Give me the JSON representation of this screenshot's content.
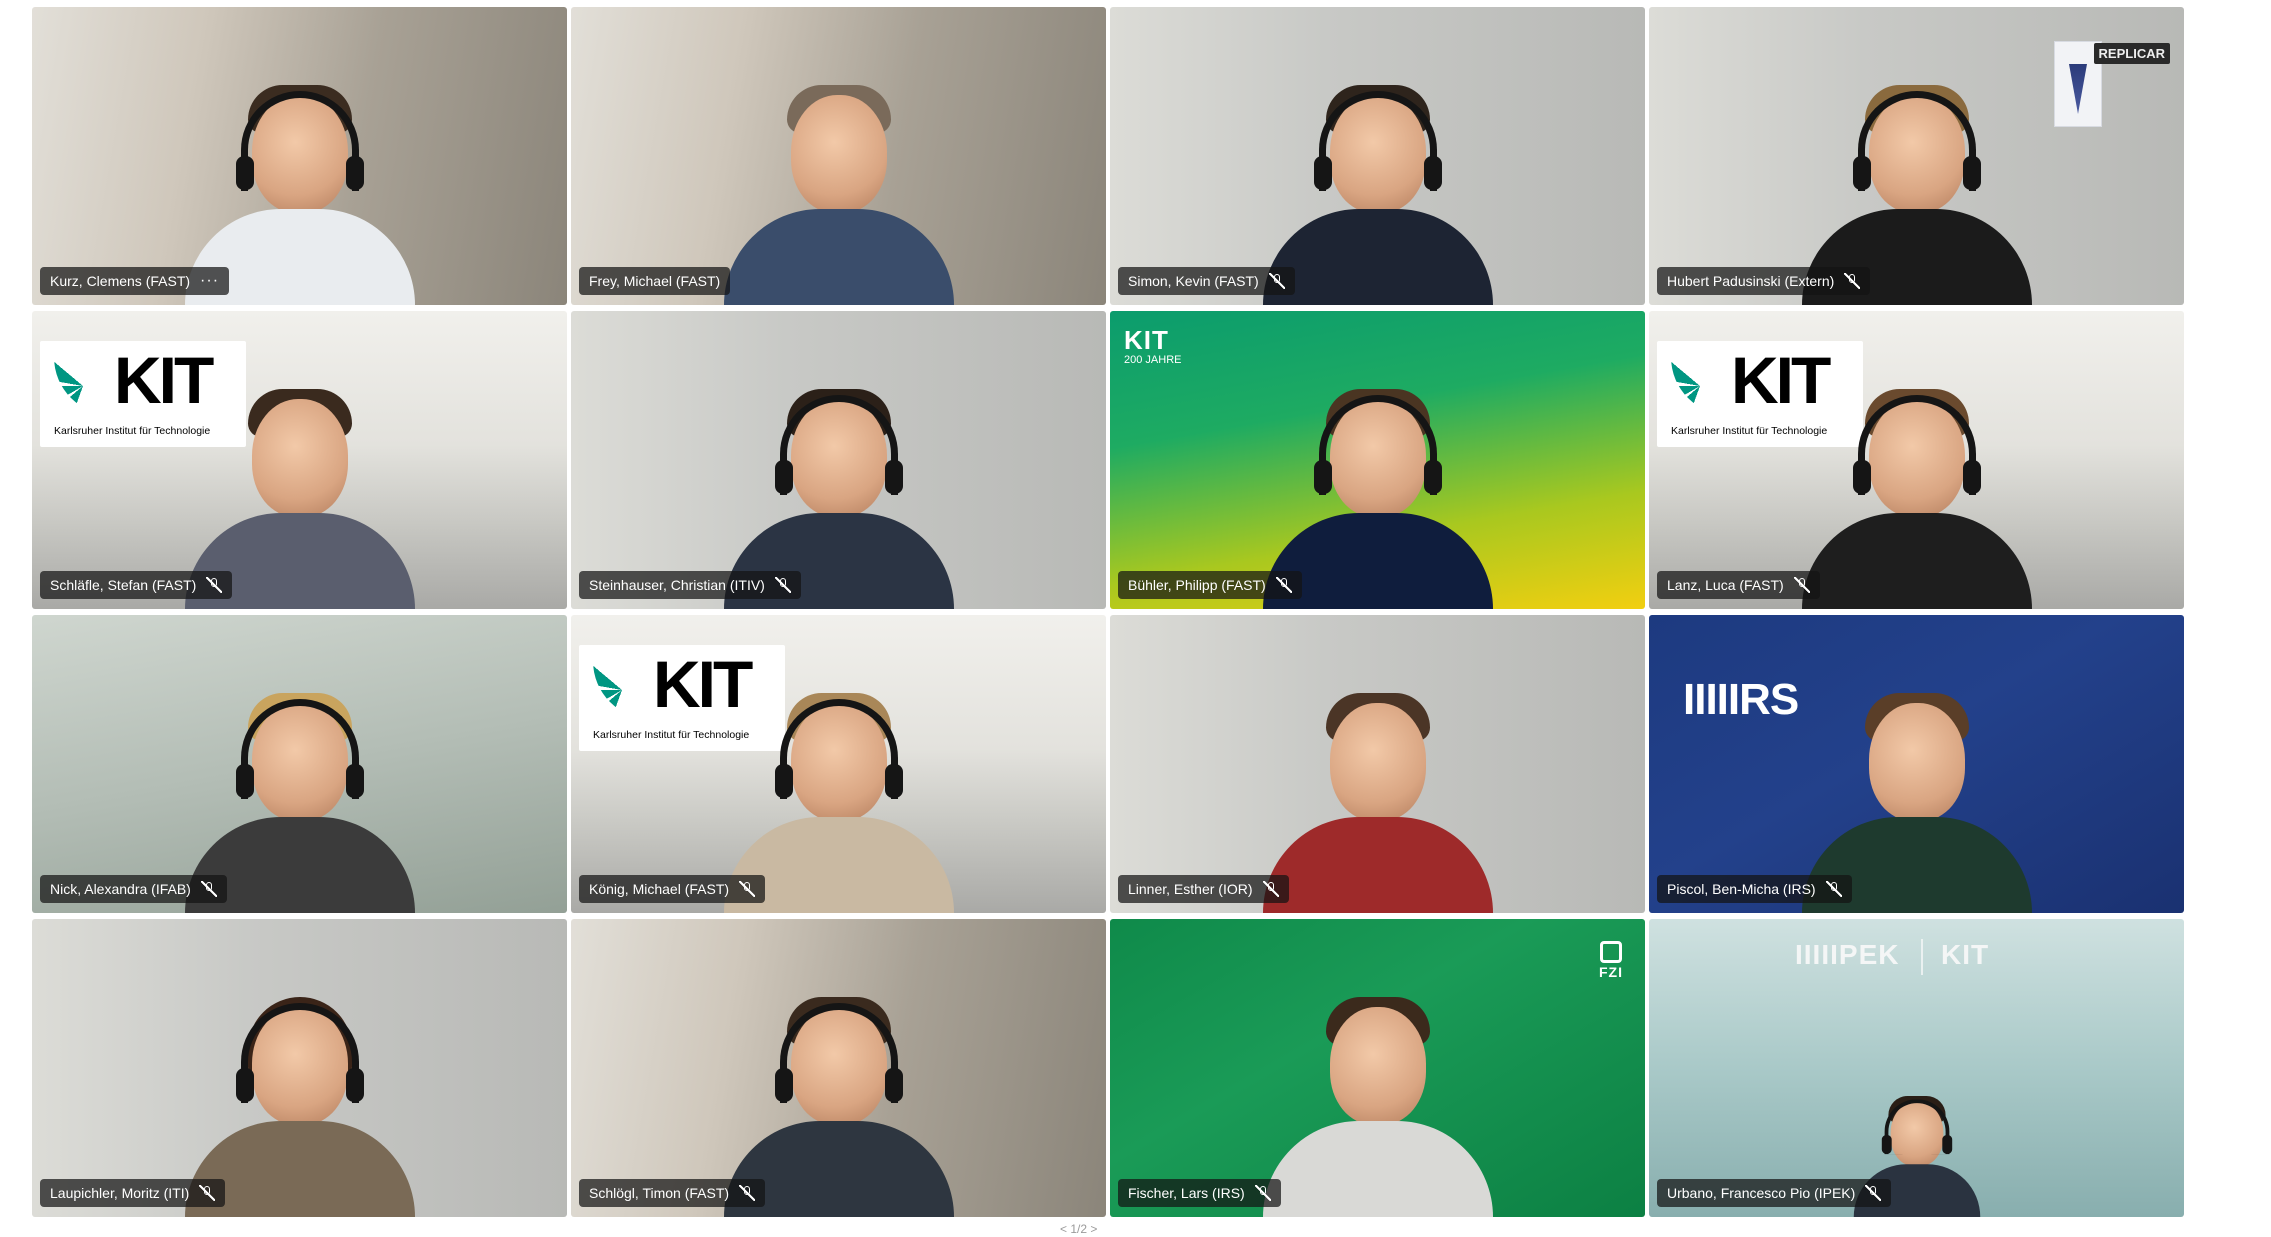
{
  "participants": [
    {
      "name": "Kurz, Clemens (FAST)",
      "control": "more",
      "more_label": "···"
    },
    {
      "name": "Frey, Michael (FAST)",
      "control": "none"
    },
    {
      "name": "Simon, Kevin (FAST)",
      "control": "muted"
    },
    {
      "name": "Hubert Padusinski (Extern)",
      "control": "muted",
      "logo_text": "REPLICAR"
    },
    {
      "name": "Schläfle, Stefan (FAST)",
      "control": "muted",
      "logo_text": "KIT",
      "logo_sub": "Karlsruher Institut für Technologie"
    },
    {
      "name": "Steinhauser, Christian (ITIV)",
      "control": "muted"
    },
    {
      "name": "Bühler, Philipp (FAST)",
      "control": "muted",
      "logo_text": "KIT",
      "logo_sub": "200 JAHRE"
    },
    {
      "name": "Lanz, Luca (FAST)",
      "control": "muted",
      "logo_text": "KIT",
      "logo_sub": "Karlsruher Institut für Technologie"
    },
    {
      "name": "Nick, Alexandra (IFAB)",
      "control": "muted"
    },
    {
      "name": "König, Michael (FAST)",
      "control": "muted",
      "logo_text": "KIT",
      "logo_sub": "Karlsruher Institut für Technologie"
    },
    {
      "name": "Linner, Esther (IOR)",
      "control": "muted"
    },
    {
      "name": "Piscol, Ben-Micha (IRS)",
      "control": "muted",
      "logo_text": "IIIIIRS"
    },
    {
      "name": "Laupichler, Moritz (ITI)",
      "control": "muted"
    },
    {
      "name": "Schlögl, Timon (FAST)",
      "control": "muted"
    },
    {
      "name": "Fischer, Lars (IRS)",
      "control": "muted",
      "logo_text": "FZI"
    },
    {
      "name": "Urbano, Francesco Pio (IPEK)",
      "control": "muted",
      "logo_text": "IIIIIPEK",
      "logo_text_2": "KIT"
    }
  ],
  "pager": {
    "label": "< 1/2 >"
  }
}
